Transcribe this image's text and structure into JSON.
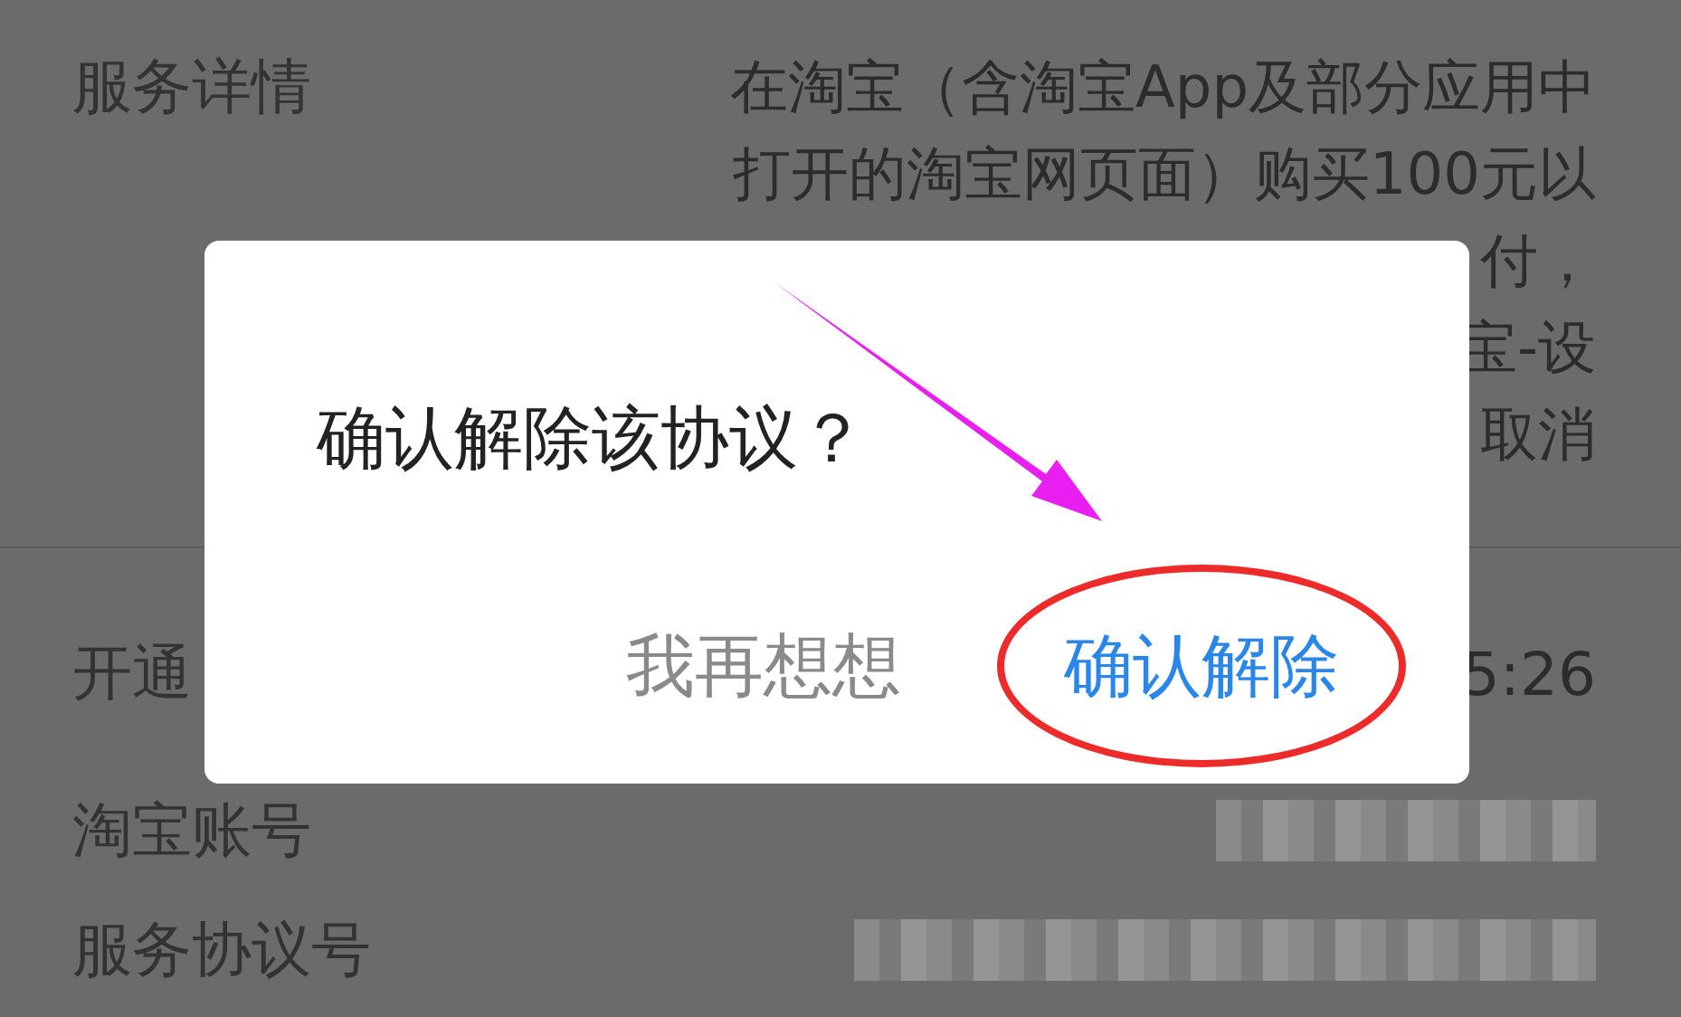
{
  "details": [
    {
      "kind": "lines",
      "label": "服务详情",
      "lines": [
        "在淘宝（含淘宝App及部分应用中",
        "打开的淘宝网页面）购买100元以",
        "付，",
        "宝-设",
        "取消"
      ]
    },
    {
      "kind": "text",
      "label": "开通",
      "value": "5:26"
    },
    {
      "kind": "blurred",
      "label": "淘宝账号"
    },
    {
      "kind": "blurred",
      "label": "服务协议号"
    }
  ],
  "dialog": {
    "title": "确认解除该协议？",
    "buttons": [
      {
        "label": "我再想想",
        "kind": "secondary",
        "highlighted": false
      },
      {
        "label": "确认解除",
        "kind": "primary",
        "highlighted": true
      }
    ]
  }
}
